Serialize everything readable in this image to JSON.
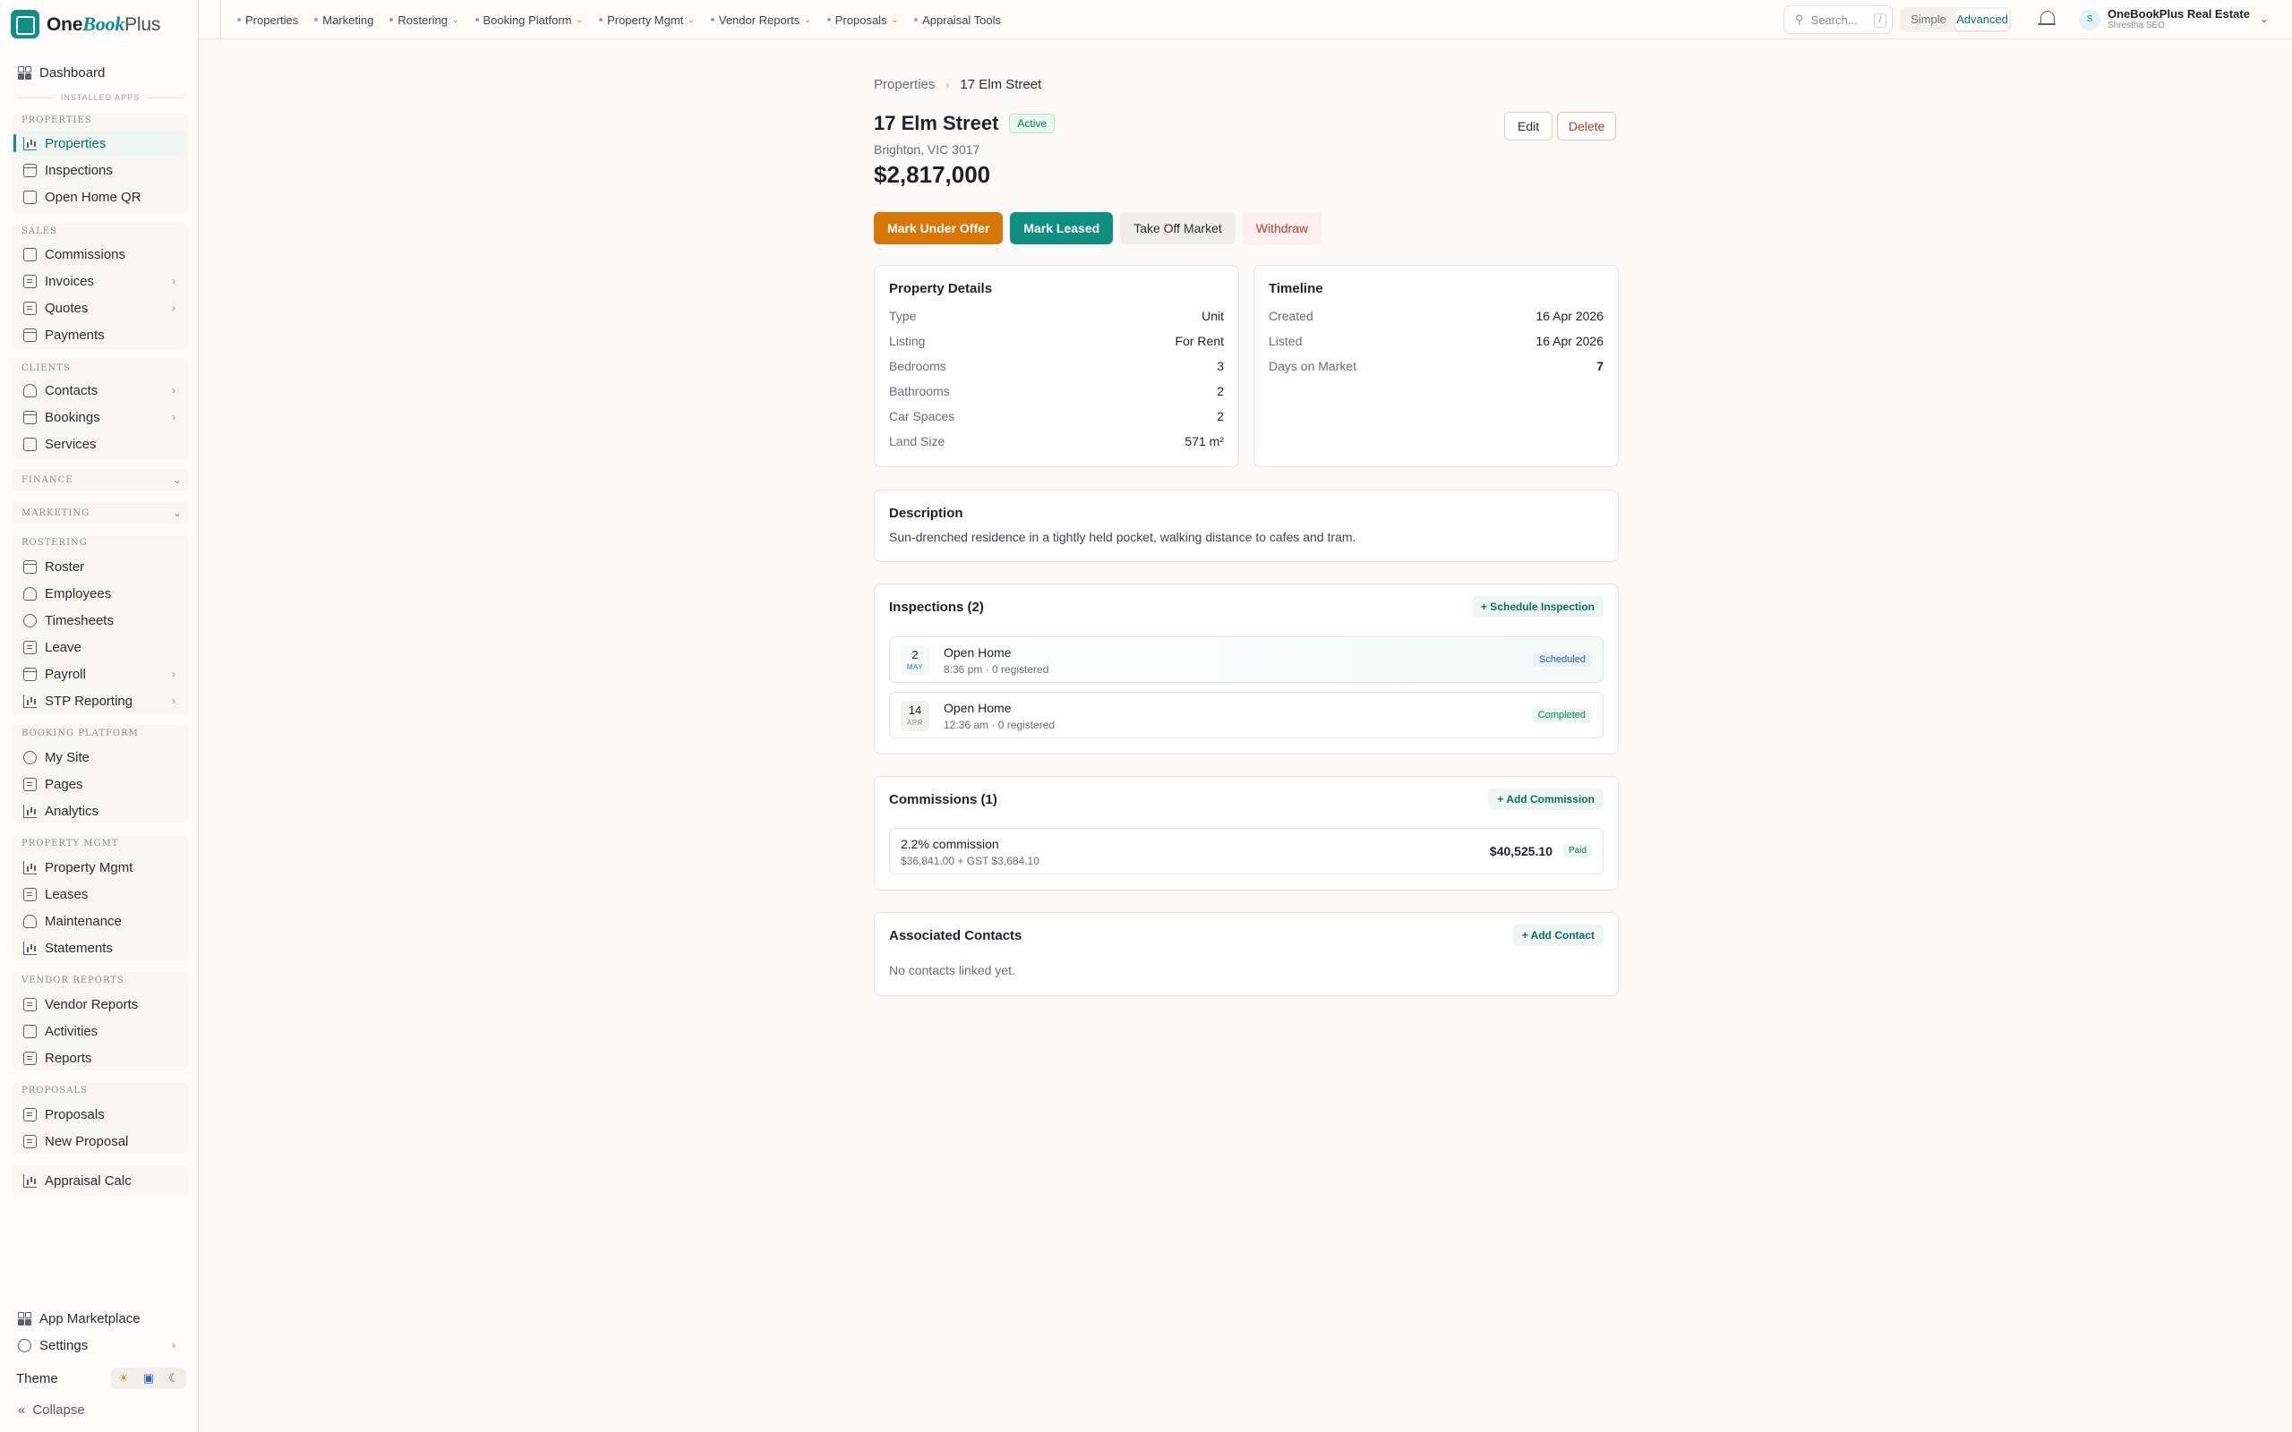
{
  "app": {
    "name_part1": "One",
    "name_part2": "Book",
    "name_part3": "Plus"
  },
  "sidebar": {
    "dashboard": "Dashboard",
    "installed_apps": "INSTALLED APPS",
    "sections": {
      "properties": "PROPERTIES",
      "sales": "SALES",
      "clients": "CLIENTS",
      "finance": "FINANCE",
      "marketing": "MARKETING",
      "rostering": "ROSTERING",
      "booking_platform": "BOOKING PLATFORM",
      "property_mgmt": "PROPERTY MGMT",
      "vendor_reports": "VENDOR REPORTS",
      "proposals": "PROPOSALS"
    },
    "items": {
      "properties": "Properties",
      "inspections": "Inspections",
      "open_home_qr": "Open Home QR",
      "commissions": "Commissions",
      "invoices": "Invoices",
      "quotes": "Quotes",
      "payments": "Payments",
      "contacts": "Contacts",
      "bookings": "Bookings",
      "services": "Services",
      "roster": "Roster",
      "employees": "Employees",
      "timesheets": "Timesheets",
      "leave": "Leave",
      "payroll": "Payroll",
      "stp_reporting": "STP Reporting",
      "my_site": "My Site",
      "pages": "Pages",
      "analytics": "Analytics",
      "property_mgmt": "Property Mgmt",
      "leases": "Leases",
      "maintenance": "Maintenance",
      "statements": "Statements",
      "vendor_reports": "Vendor Reports",
      "activities": "Activities",
      "reports": "Reports",
      "proposals": "Proposals",
      "new_proposal": "New Proposal",
      "appraisal_calc": "Appraisal Calc"
    },
    "bottom": {
      "app_marketplace": "App Marketplace",
      "settings": "Settings",
      "theme": "Theme",
      "collapse": "Collapse"
    }
  },
  "topbar": {
    "nav": [
      "Properties",
      "Marketing",
      "Rostering",
      "Booking Platform",
      "Property Mgmt",
      "Vendor Reports",
      "Proposals",
      "Appraisal Tools"
    ],
    "search_placeholder": "Search...",
    "search_shortcut": "/",
    "mode_simple": "Simple",
    "mode_advanced": "Advanced",
    "avatar_initial": "S",
    "org_name": "OneBookPlus Real Estate Ag",
    "user_name": "Shrestha SEO"
  },
  "breadcrumb": {
    "parent": "Properties",
    "current": "17 Elm Street"
  },
  "property": {
    "title": "17 Elm Street",
    "status": "Active",
    "address": "Brighton, VIC 3017",
    "price": "$2,817,000"
  },
  "header_buttons": {
    "edit": "Edit",
    "delete": "Delete"
  },
  "actions": {
    "under_offer": "Mark Under Offer",
    "leased": "Mark Leased",
    "off_market": "Take Off Market",
    "withdraw": "Withdraw"
  },
  "details": {
    "title": "Property Details",
    "rows": [
      {
        "k": "Type",
        "v": "Unit"
      },
      {
        "k": "Listing",
        "v": "For Rent"
      },
      {
        "k": "Bedrooms",
        "v": "3"
      },
      {
        "k": "Bathrooms",
        "v": "2"
      },
      {
        "k": "Car Spaces",
        "v": "2"
      },
      {
        "k": "Land Size",
        "v": "571 m²"
      }
    ]
  },
  "timeline": {
    "title": "Timeline",
    "rows": [
      {
        "k": "Created",
        "v": "16 Apr 2026"
      },
      {
        "k": "Listed",
        "v": "16 Apr 2026"
      },
      {
        "k": "Days on Market",
        "v": "7"
      }
    ]
  },
  "description": {
    "title": "Description",
    "text": "Sun-drenched residence in a tightly held pocket, walking distance to cafes and tram."
  },
  "inspections": {
    "title": "Inspections (2)",
    "add": "+ Schedule Inspection",
    "items": [
      {
        "day": "2",
        "month": "MAY",
        "title": "Open Home",
        "sub": "8:36 pm · 0 registered",
        "status": "Scheduled"
      },
      {
        "day": "14",
        "month": "APR",
        "title": "Open Home",
        "sub": "12:36 am · 0 registered",
        "status": "Completed"
      }
    ]
  },
  "commissions": {
    "title": "Commissions (1)",
    "add": "+ Add Commission",
    "items": [
      {
        "title": "2.2% commission",
        "sub": "$36,841.00 + GST $3,684.10",
        "amount": "$40,525.10",
        "status": "Paid"
      }
    ]
  },
  "contacts": {
    "title": "Associated Contacts",
    "add": "+ Add Contact",
    "empty": "No contacts linked yet."
  },
  "colors": {
    "brand": "#0f8f85",
    "orange": "#d97706",
    "teal": "#0f8f80",
    "danger": "#c0392b"
  }
}
